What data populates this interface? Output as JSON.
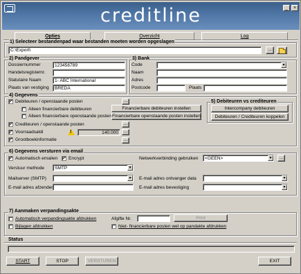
{
  "app": {
    "title": "creditline"
  },
  "tabs": {
    "opties": "Opties",
    "overzicht": "Overzicht",
    "log": "Log"
  },
  "sec1": {
    "title": "1) Selecteer bestandenpad waar bestanden moeten worden opgeslagen",
    "path": "C:\\Export\\",
    "browse_label": "..."
  },
  "sec2": {
    "title": "2) Pandgever",
    "dossiernummer_label": "Dossiernummer",
    "dossiernummer": "123456789",
    "handelsregister_label": "Handelsregisternr.",
    "handelsregister": "",
    "statutaire_label": "Statutaire Naam",
    "statutaire": "1- ABC International",
    "plaats_label": "Plaats van vestiging",
    "plaats": "BREDA"
  },
  "sec3": {
    "title": "3) Bank",
    "code_label": "Code",
    "code": "",
    "naam_label": "Naam",
    "naam": "",
    "adres_label": "Adres",
    "adres": "",
    "postcode_label": "Postcode",
    "postcode": "",
    "plaats_label": "Plaats",
    "plaats": ""
  },
  "sec4": {
    "title": "4) Gegevens",
    "debiteuren_label": "Debiteuren / openstaande posten",
    "alleen_fin_deb_label": "Alleen financierbare debiteuren",
    "alleen_fin_op_label": "Alleen financierbare openstaande posten",
    "fin_deb_btn": "Financierbare debiteuren instellen",
    "fin_op_btn": "Financierbare openstaande posten instellen",
    "crediteuren_label": "Crediteuren / openstaande posten",
    "voorraad_label": "Voorraadsaldi",
    "voorraad_value": "140.000",
    "grootboek_label": "Grootboekinformatie",
    "more": "..."
  },
  "sec5": {
    "title": "5) Debiteuren vs crediteuren",
    "intercompany_btn": "Intercompany debiteuren",
    "koppelen_btn": "Debiteuren / Crediteuren koppelen"
  },
  "sec6": {
    "title": "6) Gegevens versturen via email",
    "automatisch_label": "Automatisch emailen",
    "encrypt_label": "Encrypt",
    "netwerk_label": "Netwerkverbinding gebruiken",
    "netwerk_value": "<GEEN>",
    "verstuur_label": "Verstuur methode",
    "verstuur_value": "SMTP",
    "mailserver_label": "Mailserver (SMTP)",
    "mailserver_value": "",
    "afzender_label": "E-mail adres afzender",
    "afzender_value": "",
    "ontvanger_label": "E-mail adres ontvanger data",
    "ontvanger_value": "",
    "bevestiging_label": "E-mail adres bevestiging",
    "bevestiging_value": ""
  },
  "sec7": {
    "title": "7) Aanmaken verpandingsakte",
    "automatisch_label": "Automatisch verpandingsakte afdrukken",
    "bijlagen_label": "Bijlagen afdrukken",
    "afgifte_label": "Afgifte Nr.",
    "afgifte_value": "",
    "print_btn": "Print",
    "niet_fin_label": "Niet- financierbare posten wel op pandakte afdrukken"
  },
  "status": {
    "title": "Status",
    "text": ""
  },
  "footer": {
    "start": "START",
    "stop": "STOP",
    "versturen": "VERSTUREN",
    "exit": "EXIT"
  }
}
